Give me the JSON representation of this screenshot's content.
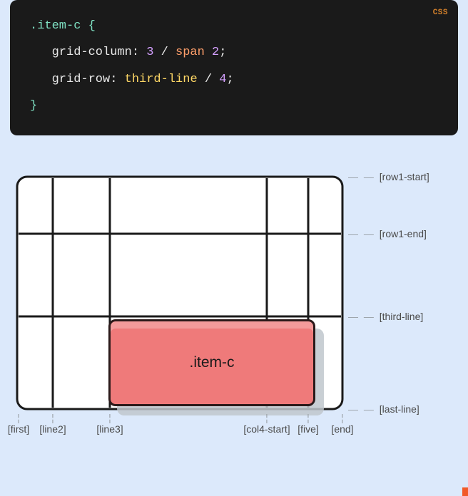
{
  "code": {
    "language": "CSS",
    "selector": ".item-c",
    "brace_open": "{",
    "brace_close": "}",
    "decl1_prop": "grid-column",
    "decl1_colon": ":",
    "decl1_v1": "3",
    "decl1_slash": "/",
    "decl1_kw": "span",
    "decl1_v2": "2",
    "decl1_semi": ";",
    "decl2_prop": "grid-row",
    "decl2_colon": ":",
    "decl2_v1": "third-line",
    "decl2_slash": "/",
    "decl2_v2": "4",
    "decl2_semi": ";"
  },
  "diagram": {
    "item_label": ".item-c",
    "row_labels": [
      "[row1-start]",
      "[row1-end]",
      "[third-line]",
      "[last-line]"
    ],
    "col_labels": [
      "[first]",
      "[line2]",
      "[line3]",
      "[col4-start]",
      "[five]",
      "[end]"
    ]
  }
}
